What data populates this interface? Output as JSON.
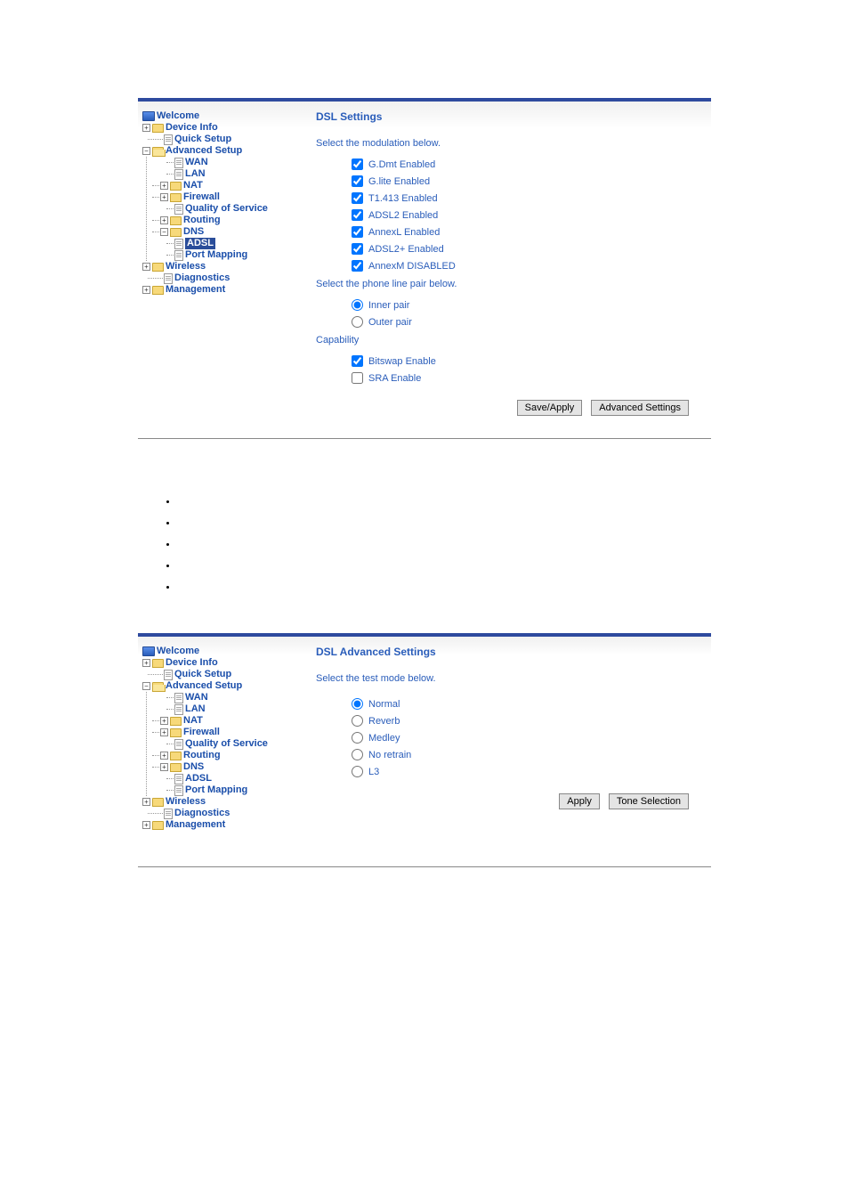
{
  "sidebar": {
    "welcome": "Welcome",
    "device_info": "Device Info",
    "quick_setup": "Quick Setup",
    "advanced_setup": "Advanced Setup",
    "wan": "WAN",
    "lan": "LAN",
    "nat": "NAT",
    "firewall": "Firewall",
    "qos": "Quality of Service",
    "routing": "Routing",
    "dns": "DNS",
    "adsl": "ADSL",
    "port_mapping": "Port Mapping",
    "wireless": "Wireless",
    "diagnostics": "Diagnostics",
    "management": "Management"
  },
  "dsl_settings": {
    "title": "DSL Settings",
    "modulation_instruction": "Select the modulation below.",
    "modulation_options": [
      {
        "label": "G.Dmt Enabled",
        "checked": true
      },
      {
        "label": "G.lite Enabled",
        "checked": true
      },
      {
        "label": "T1.413 Enabled",
        "checked": true
      },
      {
        "label": "ADSL2 Enabled",
        "checked": true
      },
      {
        "label": "AnnexL Enabled",
        "checked": true
      },
      {
        "label": "ADSL2+ Enabled",
        "checked": true
      },
      {
        "label": "AnnexM DISABLED",
        "checked": true
      }
    ],
    "pair_instruction": "Select the phone line pair below.",
    "pair_options": [
      {
        "label": "Inner pair",
        "checked": true
      },
      {
        "label": "Outer pair",
        "checked": false
      }
    ],
    "capability_title": "Capability",
    "capability_options": [
      {
        "label": "Bitswap Enable",
        "checked": true
      },
      {
        "label": "SRA Enable",
        "checked": false
      }
    ],
    "save_apply": "Save/Apply",
    "advanced_settings": "Advanced Settings"
  },
  "bullets": [
    "",
    "",
    "",
    "",
    ""
  ],
  "dsl_advanced": {
    "title": "DSL Advanced Settings",
    "instruction": "Select the test mode below.",
    "options": [
      {
        "label": "Normal",
        "checked": true
      },
      {
        "label": "Reverb",
        "checked": false
      },
      {
        "label": "Medley",
        "checked": false
      },
      {
        "label": "No retrain",
        "checked": false
      },
      {
        "label": "L3",
        "checked": false
      }
    ],
    "apply": "Apply",
    "tone_selection": "Tone Selection"
  }
}
